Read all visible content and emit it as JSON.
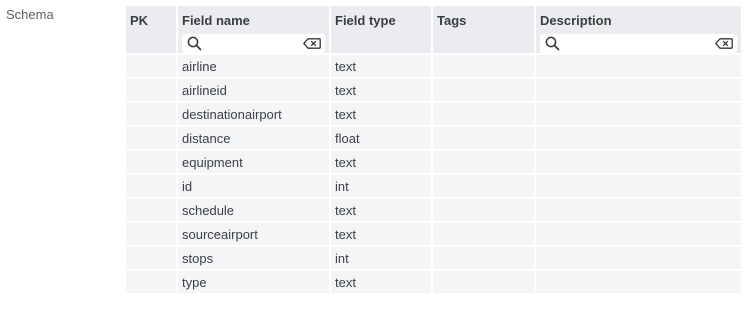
{
  "section_label": "Schema",
  "columns": {
    "pk": "PK",
    "field_name": "Field name",
    "field_type": "Field type",
    "tags": "Tags",
    "description": "Description"
  },
  "filters": {
    "field_name_placeholder": "",
    "description_placeholder": ""
  },
  "rows": [
    {
      "pk": "",
      "field_name": "airline",
      "field_type": "text",
      "tags": "",
      "description": ""
    },
    {
      "pk": "",
      "field_name": "airlineid",
      "field_type": "text",
      "tags": "",
      "description": ""
    },
    {
      "pk": "",
      "field_name": "destinationairport",
      "field_type": "text",
      "tags": "",
      "description": ""
    },
    {
      "pk": "",
      "field_name": "distance",
      "field_type": "float",
      "tags": "",
      "description": ""
    },
    {
      "pk": "",
      "field_name": "equipment",
      "field_type": "text",
      "tags": "",
      "description": ""
    },
    {
      "pk": "",
      "field_name": "id",
      "field_type": "int",
      "tags": "",
      "description": ""
    },
    {
      "pk": "",
      "field_name": "schedule",
      "field_type": "text",
      "tags": "",
      "description": ""
    },
    {
      "pk": "",
      "field_name": "sourceairport",
      "field_type": "text",
      "tags": "",
      "description": ""
    },
    {
      "pk": "",
      "field_name": "stops",
      "field_type": "int",
      "tags": "",
      "description": ""
    },
    {
      "pk": "",
      "field_name": "type",
      "field_type": "text",
      "tags": "",
      "description": ""
    }
  ],
  "icons": {
    "search": "search-icon",
    "clear": "clear-input-icon"
  }
}
